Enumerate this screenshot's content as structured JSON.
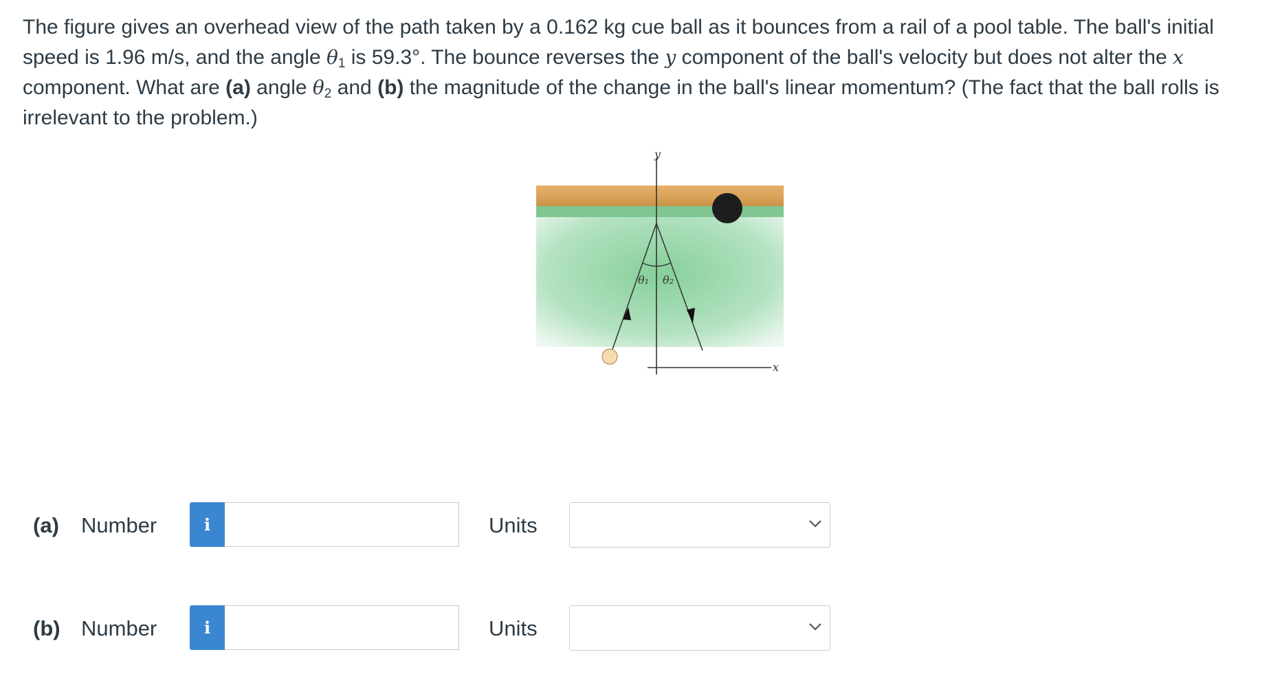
{
  "question": {
    "p1": "The figure gives an overhead view of the path taken by a 0.162 kg cue ball as it bounces from a rail of a pool table. The ball's initial speed is 1.96 m/s, and the angle ",
    "theta": "θ",
    "sub1": "1",
    "p2": " is 59.3°. The bounce reverses the ",
    "y": "y",
    "p3": " component of the ball's velocity but does not alter the ",
    "x": "x",
    "p4": " component. What are ",
    "a": "(a)",
    "p5": " angle ",
    "sub2": "2",
    "p6": " and ",
    "b": "(b)",
    "p7": " the magnitude of the change in the ball's linear momentum? (The fact that the ball rolls is irrelevant to the problem.)"
  },
  "figure": {
    "y_axis_label": "y",
    "x_axis_label": "x",
    "theta1_label": "θ₁",
    "theta2_label": "θ₂",
    "colors": {
      "rail": "#d9a35a",
      "cloth": "#8fd3a3",
      "pocket": "#222222",
      "cue_ball": "#f7dcb0"
    }
  },
  "answers": [
    {
      "part": "(a)",
      "number_label": "Number",
      "info_icon": "i",
      "number_value": "",
      "units_label": "Units",
      "units_value": ""
    },
    {
      "part": "(b)",
      "number_label": "Number",
      "info_icon": "i",
      "number_value": "",
      "units_label": "Units",
      "units_value": ""
    }
  ]
}
